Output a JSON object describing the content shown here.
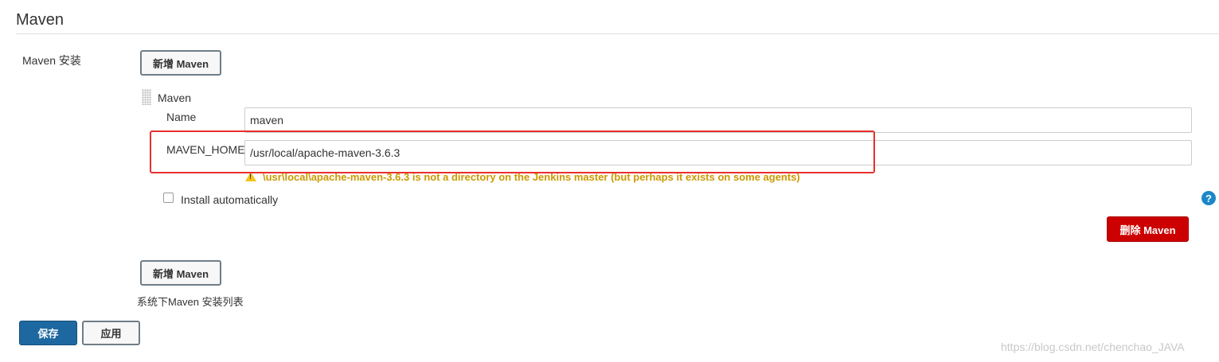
{
  "section": {
    "title": "Maven"
  },
  "maven_install": {
    "label": "Maven 安装",
    "add_button_label": "新增 Maven",
    "installation": {
      "header": "Maven",
      "name_label": "Name",
      "name_value": "maven",
      "home_label": "MAVEN_HOME",
      "home_value": "/usr/local/apache-maven-3.6.3",
      "warning_text": "\\usr\\local\\apache-maven-3.6.3 is not a directory on the Jenkins master (but perhaps it exists on some agents)",
      "install_auto_label": "Install automatically",
      "install_auto_checked": false,
      "help_icon": "question-circle-icon",
      "delete_button_label": "删除 Maven"
    },
    "add_button_label_bottom": "新增 Maven",
    "description": "系统下Maven 安装列表"
  },
  "footer": {
    "save_label": "保存",
    "apply_label": "应用"
  },
  "watermark": "https://blog.csdn.net/chenchao_JAVA",
  "colors": {
    "primary": "#1d68a0",
    "danger": "#cc0000",
    "warning": "#cc9900",
    "highlight": "#e8302e",
    "help": "#1b87c9"
  }
}
